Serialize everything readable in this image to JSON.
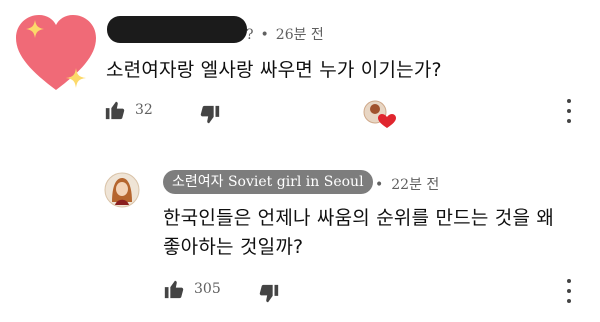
{
  "comment": {
    "meta_partial": "?",
    "separator": "•",
    "time": "26분 전",
    "text": "소련여자랑 엘사랑 싸우면 누가 이기는가?",
    "like_count": "32",
    "icons": {
      "avatar": "sparkle-heart-icon",
      "like": "thumbs-up-icon",
      "dislike": "thumbs-down-icon",
      "creator_heart": "creator-heart-icon",
      "more": "more-vertical-icon"
    }
  },
  "reply": {
    "author": "소련여자 Soviet girl in Seoul",
    "separator": "•",
    "time": "22분 전",
    "text_line1": "한국인들은 언제나 싸움의 순위를 만드는 것을 왜",
    "text_line2": "좋아하는 것일까?",
    "like_count": "305",
    "icons": {
      "avatar": "user-avatar",
      "like": "thumbs-up-icon",
      "dislike": "thumbs-down-icon",
      "more": "more-vertical-icon"
    }
  },
  "colors": {
    "heart": "#f06a77",
    "sparkle": "#fcd96a",
    "chip_bg": "#7d7d7d",
    "meta_text": "#606060",
    "icon": "#444444"
  }
}
